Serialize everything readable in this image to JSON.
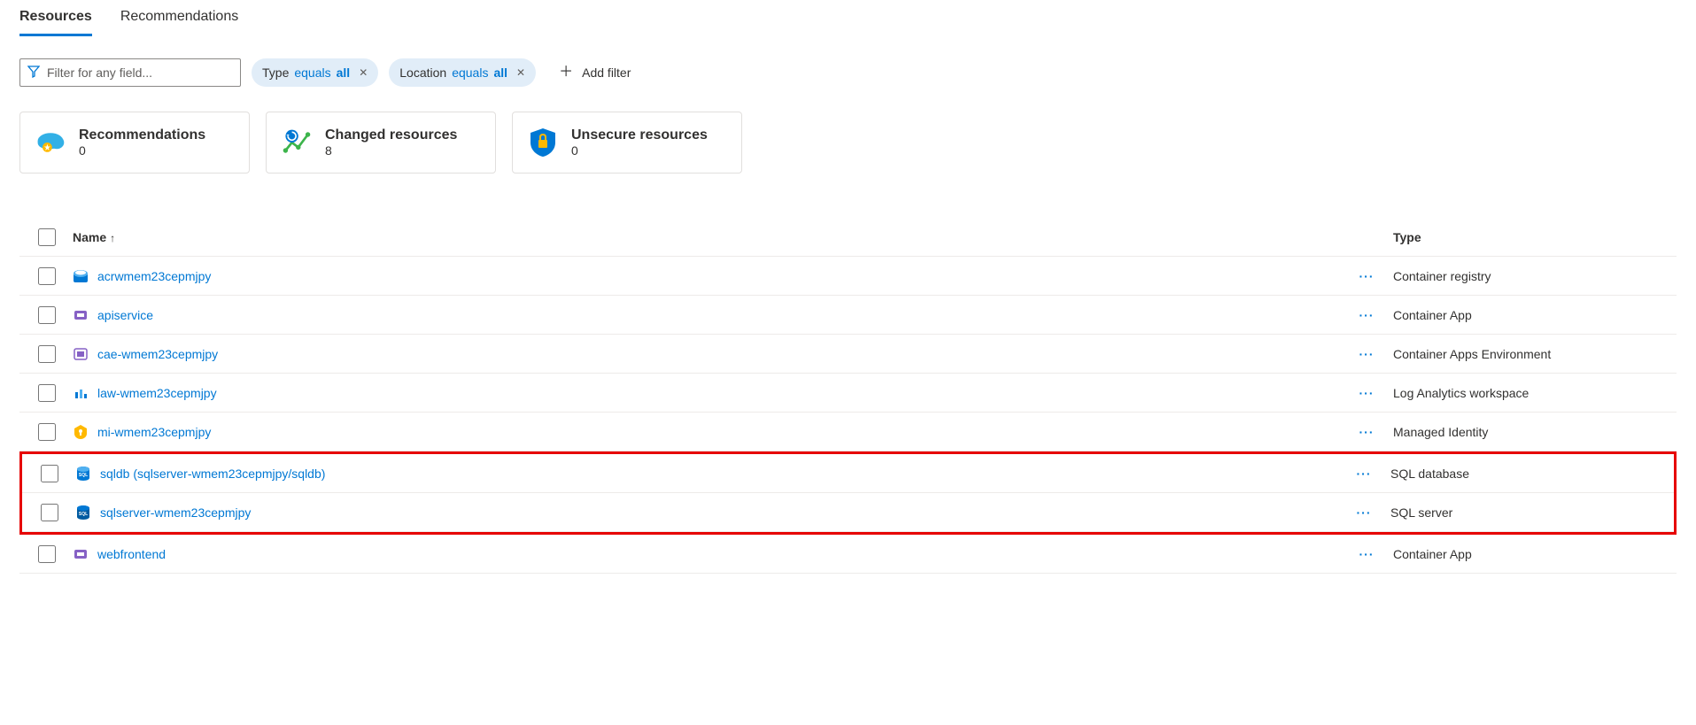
{
  "tabs": {
    "resources": "Resources",
    "recommendations": "Recommendations"
  },
  "filters": {
    "placeholder": "Filter for any field...",
    "type_label": "Type",
    "type_op": "equals",
    "type_val": "all",
    "loc_label": "Location",
    "loc_op": "equals",
    "loc_val": "all",
    "add_filter": "Add filter"
  },
  "cards": {
    "recs_title": "Recommendations",
    "recs_count": "0",
    "changed_title": "Changed resources",
    "changed_count": "8",
    "unsecure_title": "Unsecure resources",
    "unsecure_count": "0"
  },
  "columns": {
    "name": "Name",
    "type": "Type"
  },
  "rows": [
    {
      "name": "acrwmem23cepmjpy",
      "type": "Container registry",
      "icon": "acr",
      "hl": false
    },
    {
      "name": "apiservice",
      "type": "Container App",
      "icon": "capp",
      "hl": false
    },
    {
      "name": "cae-wmem23cepmjpy",
      "type": "Container Apps Environment",
      "icon": "cae",
      "hl": false
    },
    {
      "name": "law-wmem23cepmjpy",
      "type": "Log Analytics workspace",
      "icon": "law",
      "hl": false
    },
    {
      "name": "mi-wmem23cepmjpy",
      "type": "Managed Identity",
      "icon": "mi",
      "hl": false
    },
    {
      "name": "sqldb (sqlserver-wmem23cepmjpy/sqldb)",
      "type": "SQL database",
      "icon": "sqldb",
      "hl": true
    },
    {
      "name": "sqlserver-wmem23cepmjpy",
      "type": "SQL server",
      "icon": "sqlsrv",
      "hl": true
    },
    {
      "name": "webfrontend",
      "type": "Container App",
      "icon": "capp",
      "hl": false
    }
  ]
}
